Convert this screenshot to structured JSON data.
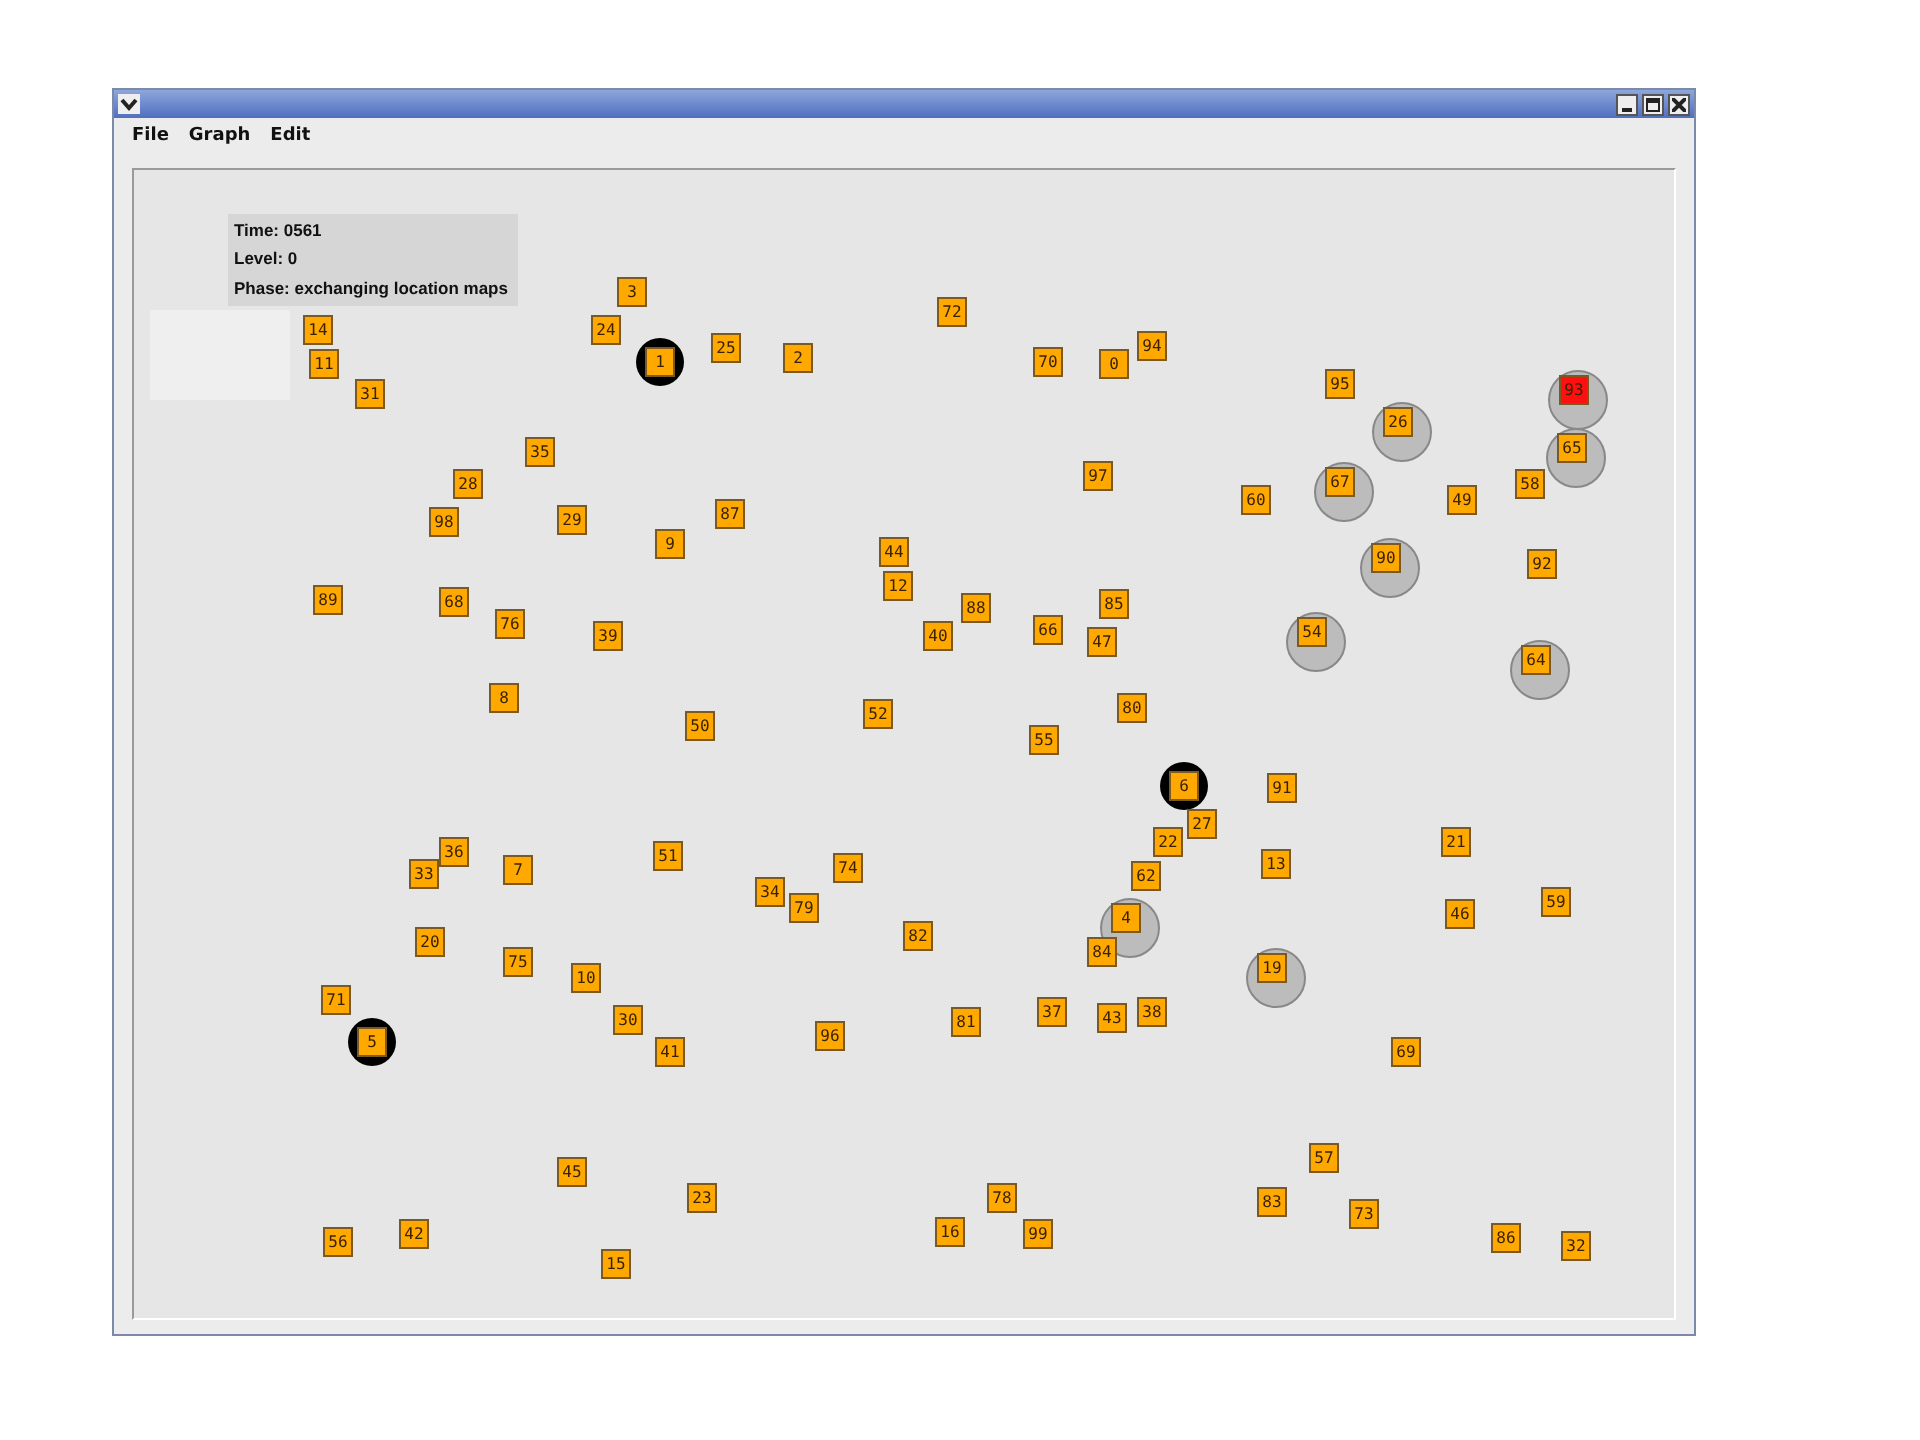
{
  "menu": [
    {
      "label": "File"
    },
    {
      "label": "Graph"
    },
    {
      "label": "Edit"
    }
  ],
  "status": {
    "time": "Time: 0561",
    "level": "Level: 0",
    "phase": "Phase: exchanging location maps"
  },
  "nodes": [
    {
      "label": "3",
      "kind": "plain",
      "ranged": false
    },
    {
      "label": "24",
      "kind": "plain",
      "ranged": false
    },
    {
      "label": "14",
      "kind": "plain",
      "ranged": false
    },
    {
      "label": "11",
      "kind": "plain",
      "ranged": false
    },
    {
      "label": "31",
      "kind": "plain",
      "ranged": false
    },
    {
      "label": "1",
      "kind": "leader",
      "ranged": false
    },
    {
      "label": "25",
      "kind": "plain",
      "ranged": false
    },
    {
      "label": "2",
      "kind": "plain",
      "ranged": false
    },
    {
      "label": "72",
      "kind": "plain",
      "ranged": false
    },
    {
      "label": "70",
      "kind": "plain",
      "ranged": false
    },
    {
      "label": "0",
      "kind": "plain",
      "ranged": false
    },
    {
      "label": "94",
      "kind": "plain",
      "ranged": false
    },
    {
      "label": "95",
      "kind": "plain",
      "ranged": false
    },
    {
      "label": "26",
      "kind": "plain",
      "ranged": true
    },
    {
      "label": "93",
      "kind": "alert",
      "ranged": true
    },
    {
      "label": "65",
      "kind": "plain",
      "ranged": true
    },
    {
      "label": "35",
      "kind": "plain",
      "ranged": false
    },
    {
      "label": "28",
      "kind": "plain",
      "ranged": false
    },
    {
      "label": "97",
      "kind": "plain",
      "ranged": false
    },
    {
      "label": "60",
      "kind": "plain",
      "ranged": false
    },
    {
      "label": "67",
      "kind": "plain",
      "ranged": true
    },
    {
      "label": "49",
      "kind": "plain",
      "ranged": false
    },
    {
      "label": "58",
      "kind": "plain",
      "ranged": false
    },
    {
      "label": "98",
      "kind": "plain",
      "ranged": false
    },
    {
      "label": "29",
      "kind": "plain",
      "ranged": false
    },
    {
      "label": "87",
      "kind": "plain",
      "ranged": false
    },
    {
      "label": "9",
      "kind": "plain",
      "ranged": false
    },
    {
      "label": "44",
      "kind": "plain",
      "ranged": false
    },
    {
      "label": "12",
      "kind": "plain",
      "ranged": false
    },
    {
      "label": "90",
      "kind": "plain",
      "ranged": true
    },
    {
      "label": "92",
      "kind": "plain",
      "ranged": false
    },
    {
      "label": "89",
      "kind": "plain",
      "ranged": false
    },
    {
      "label": "68",
      "kind": "plain",
      "ranged": false
    },
    {
      "label": "76",
      "kind": "plain",
      "ranged": false
    },
    {
      "label": "39",
      "kind": "plain",
      "ranged": false
    },
    {
      "label": "88",
      "kind": "plain",
      "ranged": false
    },
    {
      "label": "40",
      "kind": "plain",
      "ranged": false
    },
    {
      "label": "66",
      "kind": "plain",
      "ranged": false
    },
    {
      "label": "85",
      "kind": "plain",
      "ranged": false
    },
    {
      "label": "47",
      "kind": "plain",
      "ranged": false
    },
    {
      "label": "54",
      "kind": "plain",
      "ranged": true
    },
    {
      "label": "64",
      "kind": "plain",
      "ranged": true
    },
    {
      "label": "8",
      "kind": "plain",
      "ranged": false
    },
    {
      "label": "50",
      "kind": "plain",
      "ranged": false
    },
    {
      "label": "52",
      "kind": "plain",
      "ranged": false
    },
    {
      "label": "80",
      "kind": "plain",
      "ranged": false
    },
    {
      "label": "55",
      "kind": "plain",
      "ranged": false
    },
    {
      "label": "6",
      "kind": "leader",
      "ranged": false
    },
    {
      "label": "91",
      "kind": "plain",
      "ranged": false
    },
    {
      "label": "27",
      "kind": "plain",
      "ranged": false
    },
    {
      "label": "22",
      "kind": "plain",
      "ranged": false
    },
    {
      "label": "62",
      "kind": "plain",
      "ranged": false
    },
    {
      "label": "13",
      "kind": "plain",
      "ranged": false
    },
    {
      "label": "21",
      "kind": "plain",
      "ranged": false
    },
    {
      "label": "36",
      "kind": "plain",
      "ranged": false
    },
    {
      "label": "33",
      "kind": "plain",
      "ranged": false
    },
    {
      "label": "7",
      "kind": "plain",
      "ranged": false
    },
    {
      "label": "51",
      "kind": "plain",
      "ranged": false
    },
    {
      "label": "74",
      "kind": "plain",
      "ranged": false
    },
    {
      "label": "34",
      "kind": "plain",
      "ranged": false
    },
    {
      "label": "79",
      "kind": "plain",
      "ranged": false
    },
    {
      "label": "46",
      "kind": "plain",
      "ranged": false
    },
    {
      "label": "59",
      "kind": "plain",
      "ranged": false
    },
    {
      "label": "4",
      "kind": "plain",
      "ranged": true
    },
    {
      "label": "82",
      "kind": "plain",
      "ranged": false
    },
    {
      "label": "84",
      "kind": "plain",
      "ranged": false
    },
    {
      "label": "20",
      "kind": "plain",
      "ranged": false
    },
    {
      "label": "75",
      "kind": "plain",
      "ranged": false
    },
    {
      "label": "10",
      "kind": "plain",
      "ranged": false
    },
    {
      "label": "19",
      "kind": "plain",
      "ranged": true
    },
    {
      "label": "71",
      "kind": "plain",
      "ranged": false
    },
    {
      "label": "5",
      "kind": "leader",
      "ranged": false
    },
    {
      "label": "30",
      "kind": "plain",
      "ranged": false
    },
    {
      "label": "41",
      "kind": "plain",
      "ranged": false
    },
    {
      "label": "96",
      "kind": "plain",
      "ranged": false
    },
    {
      "label": "81",
      "kind": "plain",
      "ranged": false
    },
    {
      "label": "37",
      "kind": "plain",
      "ranged": false
    },
    {
      "label": "43",
      "kind": "plain",
      "ranged": false
    },
    {
      "label": "38",
      "kind": "plain",
      "ranged": false
    },
    {
      "label": "69",
      "kind": "plain",
      "ranged": false
    },
    {
      "label": "57",
      "kind": "plain",
      "ranged": false
    },
    {
      "label": "45",
      "kind": "plain",
      "ranged": false
    },
    {
      "label": "23",
      "kind": "plain",
      "ranged": false
    },
    {
      "label": "83",
      "kind": "plain",
      "ranged": false
    },
    {
      "label": "73",
      "kind": "plain",
      "ranged": false
    },
    {
      "label": "78",
      "kind": "plain",
      "ranged": false
    },
    {
      "label": "16",
      "kind": "plain",
      "ranged": false
    },
    {
      "label": "99",
      "kind": "plain",
      "ranged": false
    },
    {
      "label": "86",
      "kind": "plain",
      "ranged": false
    },
    {
      "label": "32",
      "kind": "plain",
      "ranged": false
    },
    {
      "label": "56",
      "kind": "plain",
      "ranged": false
    },
    {
      "label": "42",
      "kind": "plain",
      "ranged": false
    },
    {
      "label": "15",
      "kind": "plain",
      "ranged": false
    }
  ]
}
